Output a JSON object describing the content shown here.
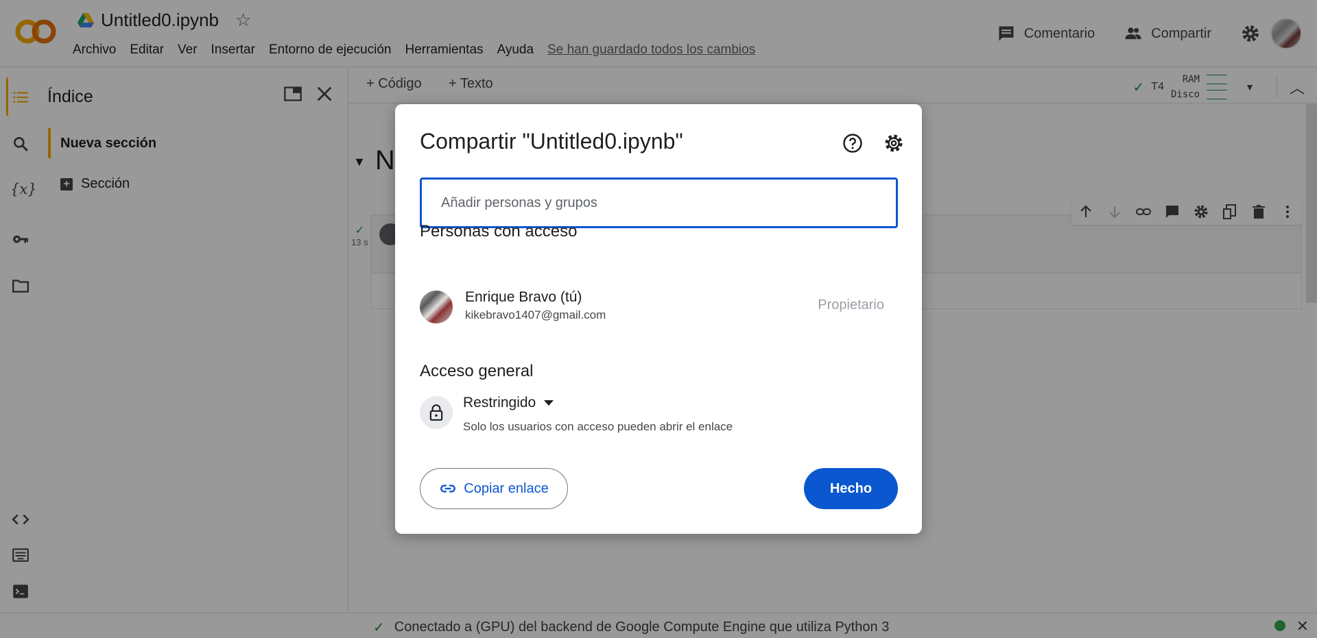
{
  "header": {
    "title": "Untitled0.ipynb",
    "logo_text": "CO",
    "menu": [
      "Archivo",
      "Editar",
      "Ver",
      "Insertar",
      "Entorno de ejecución",
      "Herramientas",
      "Ayuda"
    ],
    "saved_status": "Se han guardado todos los cambios",
    "comment_label": "Comentario",
    "share_label": "Compartir"
  },
  "sidebar": {
    "title": "Índice",
    "section_label": "Nueva sección",
    "add_section_label": "Sección"
  },
  "toolbar": {
    "add_code_label": "+ Código",
    "add_text_label": "+ Texto",
    "runtime_type": "T4",
    "ram_label": "RAM",
    "disk_label": "Disco"
  },
  "notebook": {
    "cell_heading_partial": "N",
    "cell_exec_time": "13 s"
  },
  "statusbar": {
    "text": "Conectado a (GPU) del backend de Google Compute Engine que utiliza Python 3"
  },
  "share_dialog": {
    "title": "Compartir \"Untitled0.ipynb\"",
    "input_placeholder": "Añadir personas y grupos",
    "people_heading": "Personas con acceso",
    "person": {
      "name": "Enrique Bravo (tú)",
      "email": "kikebravo1407@gmail.com",
      "role": "Propietario"
    },
    "general_heading": "Acceso general",
    "access_level": "Restringido",
    "access_description": "Solo los usuarios con acceso pueden abrir el enlace",
    "copy_link_label": "Copiar enlace",
    "done_label": "Hecho"
  },
  "colors": {
    "accent": "#0b57d0",
    "colab_orange": "#f9ab00",
    "status_green": "#34a853"
  }
}
